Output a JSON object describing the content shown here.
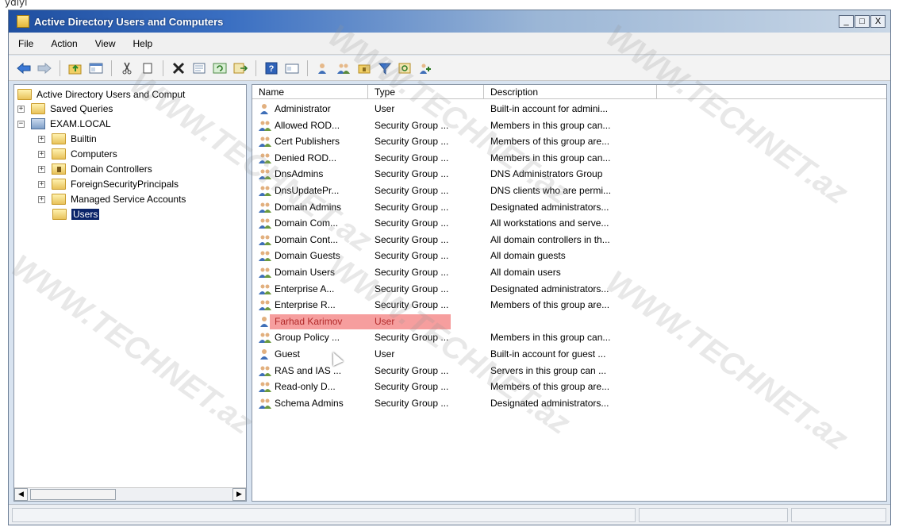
{
  "top_fragment": "ydıyı",
  "window": {
    "title": "Active Directory Users and Computers",
    "caption_buttons": [
      "_",
      "□",
      "X"
    ]
  },
  "menu": [
    "File",
    "Action",
    "View",
    "Help"
  ],
  "toolbar": {
    "icons": [
      "back-arrow-icon",
      "forward-arrow-icon",
      "up-folder-icon",
      "show-hide-console-tree-icon",
      "cut-icon",
      "copy-icon",
      "delete-icon",
      "properties-icon",
      "refresh-icon",
      "export-list-icon",
      "help-icon",
      "show-details-icon",
      "new-user-icon",
      "new-group-icon",
      "new-ou-icon",
      "filter-icon",
      "find-icon",
      "add-to-group-icon"
    ]
  },
  "tree": {
    "root": "Active Directory Users and Comput",
    "items": [
      {
        "label": "Saved Queries",
        "level": 0,
        "expandable": true,
        "type": "folder"
      },
      {
        "label": "EXAM.LOCAL",
        "level": 0,
        "expandable": true,
        "type": "domain",
        "expanded": true
      },
      {
        "label": "Builtin",
        "level": 1,
        "expandable": true,
        "type": "folder"
      },
      {
        "label": "Computers",
        "level": 1,
        "expandable": true,
        "type": "folder"
      },
      {
        "label": "Domain Controllers",
        "level": 1,
        "expandable": true,
        "type": "ou"
      },
      {
        "label": "ForeignSecurityPrincipals",
        "level": 1,
        "expandable": true,
        "type": "folder"
      },
      {
        "label": "Managed Service Accounts",
        "level": 1,
        "expandable": true,
        "type": "folder"
      },
      {
        "label": "Users",
        "level": 1,
        "expandable": false,
        "type": "folder",
        "selected": true
      }
    ]
  },
  "list": {
    "columns": [
      "Name",
      "Type",
      "Description"
    ],
    "rows": [
      {
        "name": "Administrator",
        "type": "User",
        "description": "Built-in account for admini...",
        "icon": "user"
      },
      {
        "name": "Allowed ROD...",
        "type": "Security Group ...",
        "description": "Members in this group can...",
        "icon": "group"
      },
      {
        "name": "Cert Publishers",
        "type": "Security Group ...",
        "description": "Members of this group are...",
        "icon": "group"
      },
      {
        "name": "Denied ROD...",
        "type": "Security Group ...",
        "description": "Members in this group can...",
        "icon": "group"
      },
      {
        "name": "DnsAdmins",
        "type": "Security Group ...",
        "description": "DNS Administrators Group",
        "icon": "group"
      },
      {
        "name": "DnsUpdatePr...",
        "type": "Security Group ...",
        "description": "DNS clients who are permi...",
        "icon": "group"
      },
      {
        "name": "Domain Admins",
        "type": "Security Group ...",
        "description": "Designated administrators...",
        "icon": "group"
      },
      {
        "name": "Domain Com...",
        "type": "Security Group ...",
        "description": "All workstations and serve...",
        "icon": "group"
      },
      {
        "name": "Domain Cont...",
        "type": "Security Group ...",
        "description": "All domain controllers in th...",
        "icon": "group"
      },
      {
        "name": "Domain Guests",
        "type": "Security Group ...",
        "description": "All domain guests",
        "icon": "group"
      },
      {
        "name": "Domain Users",
        "type": "Security Group ...",
        "description": "All domain users",
        "icon": "group"
      },
      {
        "name": "Enterprise A...",
        "type": "Security Group ...",
        "description": "Designated administrators...",
        "icon": "group"
      },
      {
        "name": "Enterprise R...",
        "type": "Security Group ...",
        "description": "Members of this group are...",
        "icon": "group"
      },
      {
        "name": "Farhad Karimov",
        "type": "User",
        "description": "",
        "icon": "user",
        "highlight": true
      },
      {
        "name": "Group Policy ...",
        "type": "Security Group ...",
        "description": "Members in this group can...",
        "icon": "group"
      },
      {
        "name": "Guest",
        "type": "User",
        "description": "Built-in account for guest ...",
        "icon": "user"
      },
      {
        "name": "RAS and IAS ...",
        "type": "Security Group ...",
        "description": "Servers in this group can ...",
        "icon": "group"
      },
      {
        "name": "Read-only D...",
        "type": "Security Group ...",
        "description": "Members of this group are...",
        "icon": "group"
      },
      {
        "name": "Schema Admins",
        "type": "Security Group ...",
        "description": "Designated administrators...",
        "icon": "group"
      }
    ]
  },
  "watermark": "WWW.TECHNET.az",
  "colors": {
    "title_gradient_start": "#1f4fa0",
    "selection": "#0a246a",
    "highlight": "#f59393",
    "highlight_text": "#b22a2a"
  }
}
